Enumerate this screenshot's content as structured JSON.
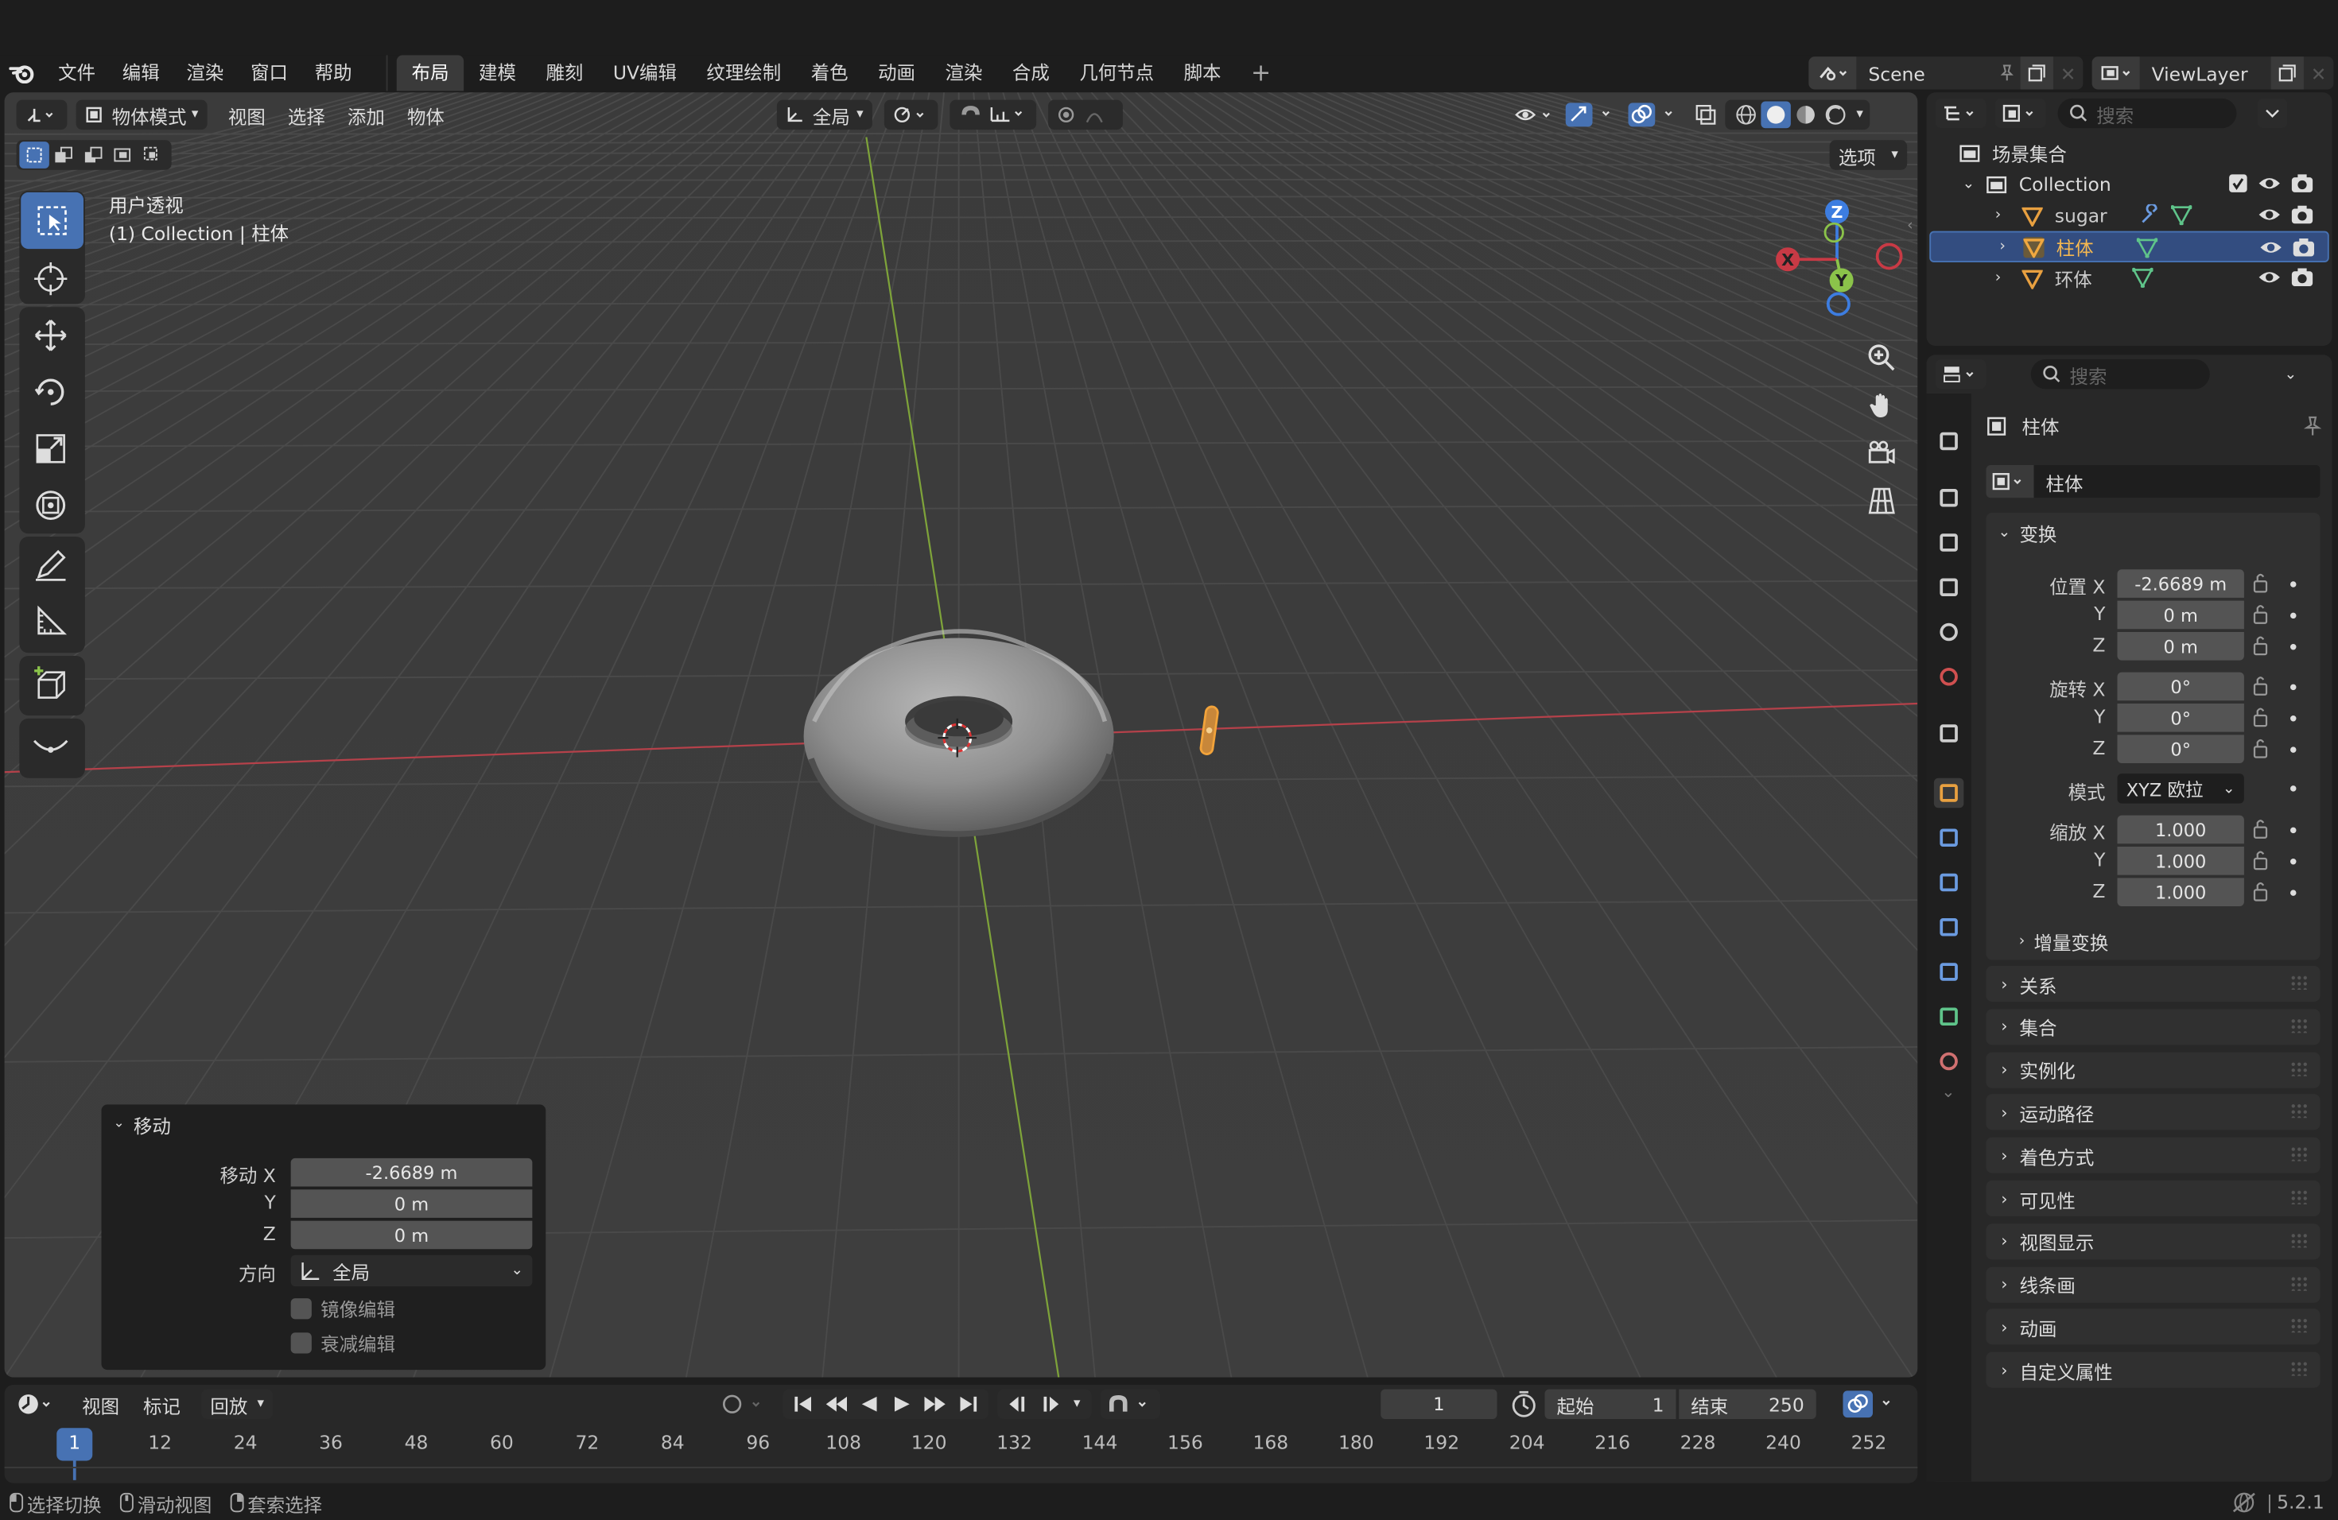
{
  "topbar": {
    "menus": [
      "文件",
      "编辑",
      "渲染",
      "窗口",
      "帮助"
    ],
    "workspaces": [
      "布局",
      "建模",
      "雕刻",
      "UV编辑",
      "纹理绘制",
      "着色",
      "动画",
      "渲染",
      "合成",
      "几何节点",
      "脚本"
    ],
    "active_workspace": "布局",
    "add_label": "+",
    "scene": "Scene",
    "view_layer": "ViewLayer"
  },
  "viewport": {
    "mode": "物体模式",
    "menus": [
      "视图",
      "选择",
      "添加",
      "物体"
    ],
    "orientation": "全局",
    "options_label": "选项",
    "overlay_line1": "用户透视",
    "overlay_line2": "(1) Collection | 柱体",
    "gizmo": {
      "x": "X",
      "y": "Y",
      "z": "Z"
    }
  },
  "operator_panel": {
    "title": "移动",
    "move_x_label": "移动 X",
    "move_x": "-2.6689 m",
    "y_label": "Y",
    "move_y": "0 m",
    "z_label": "Z",
    "move_z": "0 m",
    "orient_label": "方向",
    "orient_value": "全局",
    "mirror_label": "镜像编辑",
    "falloff_label": "衰减编辑"
  },
  "outliner": {
    "search_placeholder": "搜索",
    "scene_collection": "场景集合",
    "collection": "Collection",
    "items": [
      "sugar",
      "柱体",
      "环体"
    ],
    "selected": "柱体"
  },
  "properties": {
    "search_placeholder": "搜索",
    "object_name": "柱体",
    "object_field": "柱体",
    "transform_title": "变换",
    "location_label": "位置 X",
    "loc_x": "-2.6689 m",
    "loc_y": "0 m",
    "loc_z": "0 m",
    "rotation_label": "旋转 X",
    "rot_x": "0°",
    "rot_y": "0°",
    "rot_z": "0°",
    "mode_label": "模式",
    "mode_value": "XYZ 欧拉",
    "scale_label": "缩放 X",
    "scale_x": "1.000",
    "scale_y": "1.000",
    "scale_z": "1.000",
    "y": "Y",
    "z": "Z",
    "delta_label": "增量变换",
    "panels": [
      "关系",
      "集合",
      "实例化",
      "运动路径",
      "着色方式",
      "可见性",
      "视图显示",
      "线条画",
      "动画",
      "自定义属性"
    ]
  },
  "timeline": {
    "menus": [
      "视图",
      "标记"
    ],
    "playback": "回放",
    "current_frame": "1",
    "start_label": "起始",
    "start": "1",
    "end_label": "结束",
    "end": "250",
    "ticks": [
      "1",
      "12",
      "24",
      "36",
      "48",
      "60",
      "72",
      "84",
      "96",
      "108",
      "120",
      "132",
      "144",
      "156",
      "168",
      "180",
      "192",
      "204",
      "216",
      "228",
      "240",
      "252"
    ]
  },
  "status": {
    "items": [
      "选择切换",
      "滑动视图",
      "套索选择"
    ],
    "version": "5.2.1"
  },
  "colors": {
    "accent": "#4772b3",
    "selected_object": "#e8a040",
    "x_axis": "#c83a45",
    "y_axis": "#8bc34a",
    "z_axis": "#3d7de0"
  }
}
